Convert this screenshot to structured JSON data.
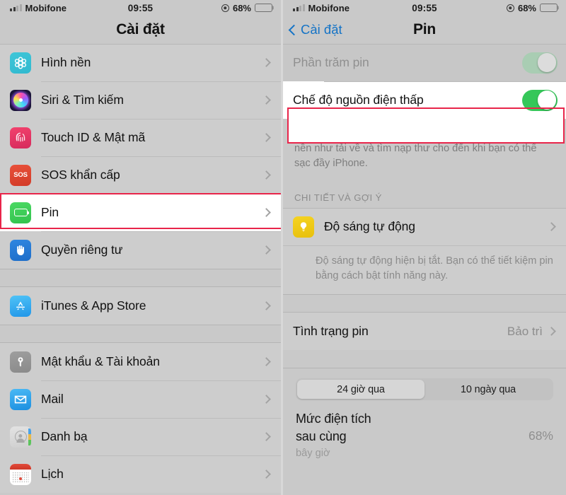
{
  "left": {
    "status": {
      "carrier": "Mobifone",
      "time": "09:55",
      "battery_pct": "68%",
      "signal_icon": "signal-bars-icon",
      "location_icon": "location-services-icon",
      "battery_icon": "battery-icon"
    },
    "nav": {
      "title": "Cài đặt"
    },
    "groups": [
      {
        "items": [
          {
            "label": "Hình nền",
            "icon": "wallpaper-icon"
          },
          {
            "label": "Siri & Tìm kiếm",
            "icon": "siri-icon"
          },
          {
            "label": "Touch ID & Mật mã",
            "icon": "touch-id-icon"
          },
          {
            "label": "SOS khẩn cấp",
            "icon": "sos-icon"
          },
          {
            "label": "Pin",
            "icon": "battery-green-icon",
            "highlighted": true
          },
          {
            "label": "Quyền riêng tư",
            "icon": "privacy-hand-icon"
          }
        ]
      },
      {
        "items": [
          {
            "label": "iTunes & App Store",
            "icon": "app-store-icon"
          }
        ]
      },
      {
        "items": [
          {
            "label": "Mật khẩu & Tài khoản",
            "icon": "key-icon"
          },
          {
            "label": "Mail",
            "icon": "mail-icon"
          },
          {
            "label": "Danh bạ",
            "icon": "contacts-icon"
          },
          {
            "label": "Lịch",
            "icon": "calendar-icon"
          }
        ]
      }
    ]
  },
  "right": {
    "status": {
      "carrier": "Mobifone",
      "time": "09:55",
      "battery_pct": "68%",
      "signal_icon": "signal-bars-icon",
      "location_icon": "location-services-icon",
      "battery_icon": "battery-low-power-icon"
    },
    "nav": {
      "back_label": "Cài đặt",
      "title": "Pin",
      "back_icon": "chevron-left-icon"
    },
    "battery_percentage_row": {
      "label": "Phần trăm pin",
      "toggle": "off-dimmed"
    },
    "low_power_row": {
      "label": "Chế độ nguồn điện thấp",
      "toggle": "on",
      "highlighted": true
    },
    "low_power_note": "Chế độ nguồn điện thấp tạm thời giảm hoạt động trong nền như tải về và tìm nạp thư cho đến khi bạn có thể sạc đầy iPhone.",
    "details_header": "CHI TIẾT VÀ GỢI Ý",
    "auto_brightness_row": {
      "label": "Độ sáng tự động",
      "icon": "brightness-bulb-icon"
    },
    "auto_brightness_note": "Độ sáng tự động hiện bị tắt. Bạn có thể tiết kiệm pin bằng cách bật tính năng này.",
    "battery_health_row": {
      "label": "Tình trạng pin",
      "value": "Bảo trì"
    },
    "segmented": {
      "options": [
        "24 giờ qua",
        "10 ngày qua"
      ],
      "selected": "24 giờ qua"
    },
    "last_level": {
      "title_line1": "Mức điện tích",
      "title_line2": "sau cùng",
      "subtitle": "bây giờ",
      "value": "68%"
    }
  },
  "colors": {
    "highlight": "#e8254a",
    "toggle_on": "#35c759",
    "accent_blue": "#1473c6",
    "low_power_yellow": "#f2d600"
  }
}
